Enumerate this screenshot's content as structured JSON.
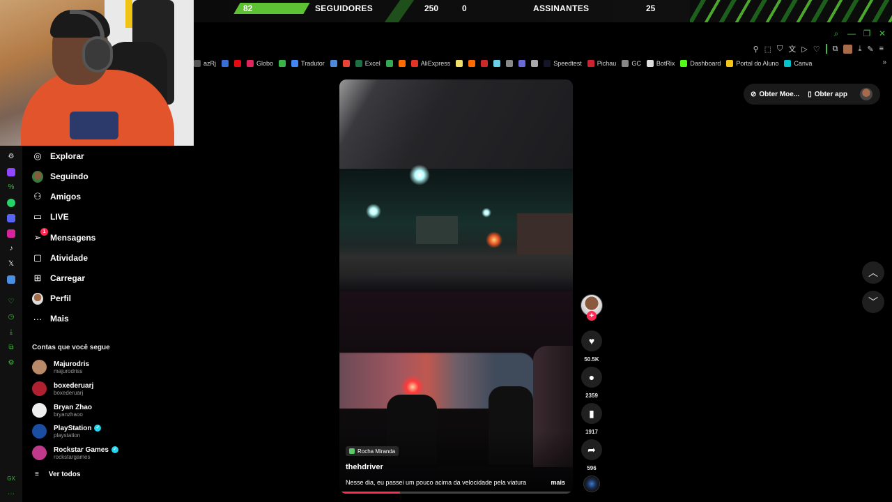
{
  "overlay": {
    "followers_label": "SEGUIDORES",
    "followers_count": "82",
    "followers_value_a": "250",
    "followers_value_b": "0",
    "subs_label": "ASSINANTES",
    "subs_count": "25",
    "accent_color": "#5dc334"
  },
  "browser": {
    "bookmarks": [
      {
        "label": "azRj",
        "color": "#555"
      },
      {
        "label": "",
        "color": "#3b6fd8"
      },
      {
        "label": "",
        "color": "#e50914"
      },
      {
        "label": "Globo",
        "color": "#e0245e"
      },
      {
        "label": "",
        "color": "#3ab54a"
      },
      {
        "label": "Tradutor",
        "color": "#4285f4"
      },
      {
        "label": "",
        "color": "#4f8ad8"
      },
      {
        "label": "",
        "color": "#ea4335"
      },
      {
        "label": "Excel",
        "color": "#1d7044"
      },
      {
        "label": "",
        "color": "#34a853"
      },
      {
        "label": "",
        "color": "#ff6d00"
      },
      {
        "label": "AliExpress",
        "color": "#e43225"
      },
      {
        "label": "",
        "color": "#f2e06b"
      },
      {
        "label": "",
        "color": "#ff6a00"
      },
      {
        "label": "",
        "color": "#cc2a2a"
      },
      {
        "label": "",
        "color": "#6ad0e8"
      },
      {
        "label": "",
        "color": "#888"
      },
      {
        "label": "",
        "color": "#6b6bd8"
      },
      {
        "label": "",
        "color": "#aaa"
      },
      {
        "label": "Speedtest",
        "color": "#141526"
      },
      {
        "label": "Pichau",
        "color": "#d02030"
      },
      {
        "label": "GC",
        "color": "#888"
      },
      {
        "label": "BotRix",
        "color": "#ddd"
      },
      {
        "label": "Dashboard",
        "color": "#53fc18"
      },
      {
        "label": "Portal do Aluno",
        "color": "#f5c518"
      },
      {
        "label": "Canva",
        "color": "#00c4cc"
      }
    ]
  },
  "sidebar": {
    "nav": [
      {
        "label": "Explorar",
        "icon": "compass-icon"
      },
      {
        "label": "Seguindo",
        "icon": "following-avatar-icon"
      },
      {
        "label": "Amigos",
        "icon": "friends-icon"
      },
      {
        "label": "LIVE",
        "icon": "live-tv-icon"
      },
      {
        "label": "Mensagens",
        "icon": "send-icon",
        "badge": "1"
      },
      {
        "label": "Atividade",
        "icon": "activity-icon"
      },
      {
        "label": "Carregar",
        "icon": "upload-plus-icon"
      },
      {
        "label": "Perfil",
        "icon": "profile-avatar-icon"
      },
      {
        "label": "Mais",
        "icon": "more-dots-icon"
      }
    ],
    "following_title": "Contas que você segue",
    "accounts": [
      {
        "name": "Majurodris",
        "handle": "majurodriss",
        "color": "#b98a6a",
        "verified": false
      },
      {
        "name": "boxederuarj",
        "handle": "boxederuarj",
        "color": "#b02030",
        "verified": false
      },
      {
        "name": "Bryan Zhao",
        "handle": "bryanzhaoo",
        "color": "#eeeeee",
        "verified": false
      },
      {
        "name": "PlayStation",
        "handle": "playstation",
        "color": "#1b4ea0",
        "verified": true
      },
      {
        "name": "Rockstar Games",
        "handle": "rockstargames",
        "color": "#c0398a",
        "verified": true
      }
    ],
    "see_all": "Ver todos"
  },
  "topbar": {
    "coins": "Obter Moe...",
    "app": "Obter app"
  },
  "video": {
    "location": "Rocha Miranda",
    "author": "thehdriver",
    "caption": "Nesse dia, eu passei um pouco acima da velocidade pela viatura",
    "more": "mais",
    "progress_percent": 26
  },
  "actions": {
    "likes": "50.5K",
    "comments": "2359",
    "saves": "1917",
    "shares": "596"
  }
}
